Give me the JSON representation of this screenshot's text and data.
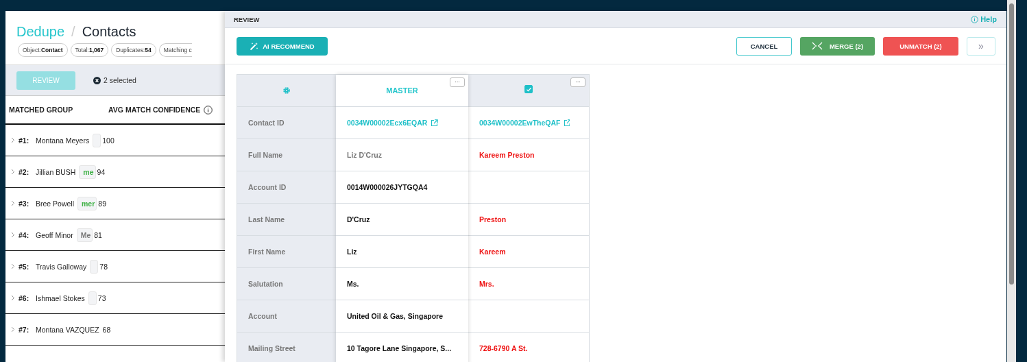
{
  "page": {
    "breadcrumb": {
      "root": "Dedupe",
      "separator": "/",
      "current": "Contacts"
    },
    "chips": [
      {
        "label": "Object:",
        "value": "Contact"
      },
      {
        "label": "Total:",
        "value": "1,067"
      },
      {
        "label": "Duplicates:",
        "value": "54"
      },
      {
        "label": "Matching c"
      }
    ],
    "toolbar": {
      "review_button": {
        "label": "REVIEW",
        "disabled": true
      },
      "selection": "2 selected"
    },
    "columns": [
      "MATCHED GROUP",
      "AVG MATCH CONFIDENCE"
    ],
    "rows": [
      {
        "number": "#1:",
        "name": "Montana Meyers",
        "has_chip": true,
        "score": "100"
      },
      {
        "number": "#2:",
        "name": "Jillian BUSH",
        "has_chip": true,
        "chip_text": "me",
        "color": "#3cb043",
        "score": "94"
      },
      {
        "number": "#3:",
        "name": "Bree Powell",
        "has_chip": true,
        "chip_text": "mer",
        "color": "#3cb043",
        "score": "89"
      },
      {
        "number": "#4:",
        "name": "Geoff Minor",
        "has_chip": true,
        "chip_text": "Me",
        "color": "#777777",
        "score": "81"
      },
      {
        "number": "#5:",
        "name": "Travis Galloway",
        "has_chip": true,
        "score": "78"
      },
      {
        "number": "#6:",
        "name": "Ishmael Stokes",
        "has_chip": true,
        "score": "73"
      },
      {
        "number": "#7:",
        "name": "Montana VAZQUEZ",
        "has_chip": false,
        "score": "68"
      }
    ]
  },
  "review": {
    "title": "REVIEW",
    "help": "Help",
    "ai_button": "AI RECOMMEND",
    "actions": [
      {
        "kind": "outline",
        "label": "CANCEL"
      },
      {
        "kind": "merge",
        "label": "MERGE (2)"
      },
      {
        "kind": "danger",
        "label": "UNMATCH (2)"
      },
      {
        "kind": "expand",
        "label": "»"
      }
    ],
    "master_header": "MASTER",
    "duplicate_checked": true,
    "more": "···",
    "fields": [
      {
        "label": "Contact ID",
        "master": {
          "text": "0034W00002Ecx6EQAR",
          "kind": "link"
        },
        "duplicate": {
          "text": "0034W00002EwTheQAF",
          "kind": "link"
        }
      },
      {
        "label": "Full Name",
        "master": {
          "text": "Liz D'Cruz",
          "kind": "muted"
        },
        "duplicate": {
          "text": "Kareem Preston",
          "kind": "diff"
        }
      },
      {
        "label": "Account ID",
        "master": {
          "text": "0014W000026JYTGQA4",
          "kind": "value"
        }
      },
      {
        "label": "Last Name",
        "master": {
          "text": "D'Cruz",
          "kind": "value"
        },
        "duplicate": {
          "text": "Preston",
          "kind": "diff"
        }
      },
      {
        "label": "First Name",
        "master": {
          "text": "Liz",
          "kind": "value"
        },
        "duplicate": {
          "text": "Kareem",
          "kind": "diff"
        }
      },
      {
        "label": "Salutation",
        "master": {
          "text": "Ms.",
          "kind": "value"
        },
        "duplicate": {
          "text": "Mrs.",
          "kind": "diff"
        }
      },
      {
        "label": "Account",
        "master": {
          "text": "United Oil & Gas, Singapore",
          "kind": "value"
        }
      },
      {
        "label": "Mailing Street",
        "master": {
          "text": "10 Tagore Lane Singapore, S...",
          "kind": "value"
        },
        "duplicate": {
          "text": "728-6790 A St.",
          "kind": "diff"
        }
      }
    ]
  }
}
